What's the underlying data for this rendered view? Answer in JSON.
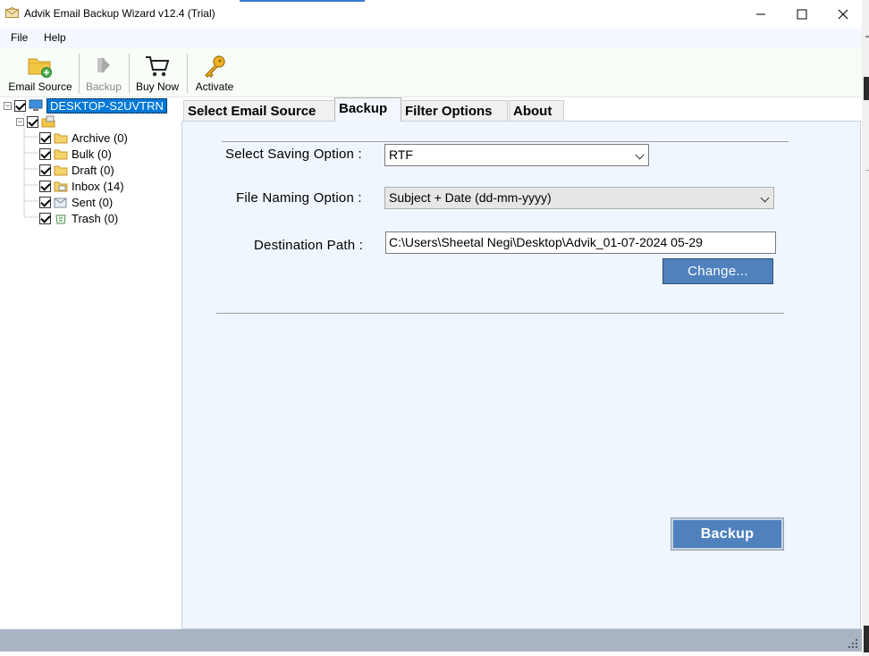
{
  "window": {
    "title": "Advik Email Backup Wizard v12.4 (Trial)",
    "icons": [
      "app-envelope-icon",
      "minimize-icon",
      "maximize-icon",
      "close-icon"
    ]
  },
  "menu": {
    "items": [
      {
        "label": "File"
      },
      {
        "label": "Help"
      }
    ]
  },
  "toolbar": {
    "email_source": {
      "label": "Email Source",
      "icon": "folder-add-icon"
    },
    "backup": {
      "label": "Backup",
      "icon": "play-arrow-icon",
      "enabled": false
    },
    "buy_now": {
      "label": "Buy Now",
      "icon": "shopping-cart-icon"
    },
    "activate": {
      "label": "Activate",
      "icon": "key-icon"
    }
  },
  "tree": {
    "root": {
      "label": "DESKTOP-S2UVTRN",
      "checked": true,
      "icon": "computer-icon"
    },
    "store": {
      "checked": true,
      "icon": "mail-store-icon"
    },
    "folders": [
      {
        "label": "Archive (0)",
        "checked": true,
        "icon": "folder-icon"
      },
      {
        "label": "Bulk (0)",
        "checked": true,
        "icon": "folder-icon"
      },
      {
        "label": "Draft (0)",
        "checked": true,
        "icon": "folder-icon"
      },
      {
        "label": "Inbox (14)",
        "checked": true,
        "icon": "inbox-folder-icon"
      },
      {
        "label": "Sent (0)",
        "checked": true,
        "icon": "sent-folder-icon"
      },
      {
        "label": "Trash (0)",
        "checked": true,
        "icon": "recycle-bin-icon"
      }
    ]
  },
  "tabs": [
    {
      "label": "Select Email Source",
      "active": false
    },
    {
      "label": "Backup",
      "active": true
    },
    {
      "label": "Filter Options",
      "active": false
    },
    {
      "label": "About",
      "active": false
    }
  ],
  "backup_tab": {
    "saving_option": {
      "label": "Select Saving Option :",
      "value": "RTF"
    },
    "file_naming": {
      "label": "File Naming Option :",
      "value": "Subject + Date (dd-mm-yyyy)"
    },
    "destination": {
      "label": "Destination Path :",
      "value": "C:\\Users\\Sheetal Negi\\Desktop\\Advik_01-07-2024 05-29"
    },
    "change_button": "Change...",
    "backup_button": "Backup"
  },
  "colors": {
    "accent_button": "#4f81bd",
    "selection": "#0078d7",
    "content_bg": "#f0f6fd",
    "statusbar": "#a8b4c4"
  }
}
